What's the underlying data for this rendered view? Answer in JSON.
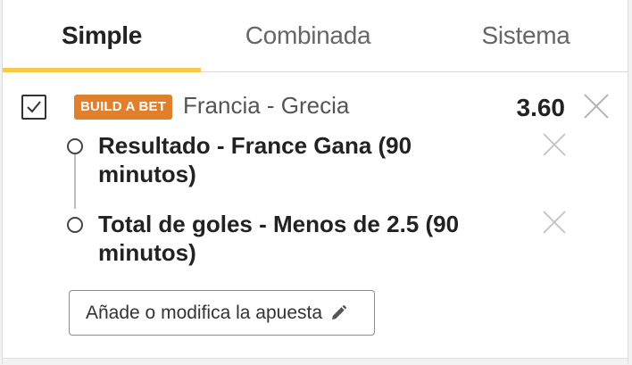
{
  "tabs": [
    {
      "label": "Simple",
      "active": true
    },
    {
      "label": "Combinada",
      "active": false
    },
    {
      "label": "Sistema",
      "active": false
    }
  ],
  "colors": {
    "tab_underline": "#f7c94a",
    "badge_bg": "#e07f2c"
  },
  "bet": {
    "checked": true,
    "badge": "BUILD A BET",
    "match": "Francia - Grecia",
    "odds": "3.60",
    "selections": [
      {
        "text": "Resultado - France Gana (90 minutos)"
      },
      {
        "text": "Total de goles - Menos de 2.5 (90 minutos)"
      }
    ],
    "modify_label": "Añade o modifica la apuesta"
  },
  "icons": {
    "checkbox": "checkmark-icon",
    "remove": "close-icon",
    "edit": "pencil-icon"
  }
}
